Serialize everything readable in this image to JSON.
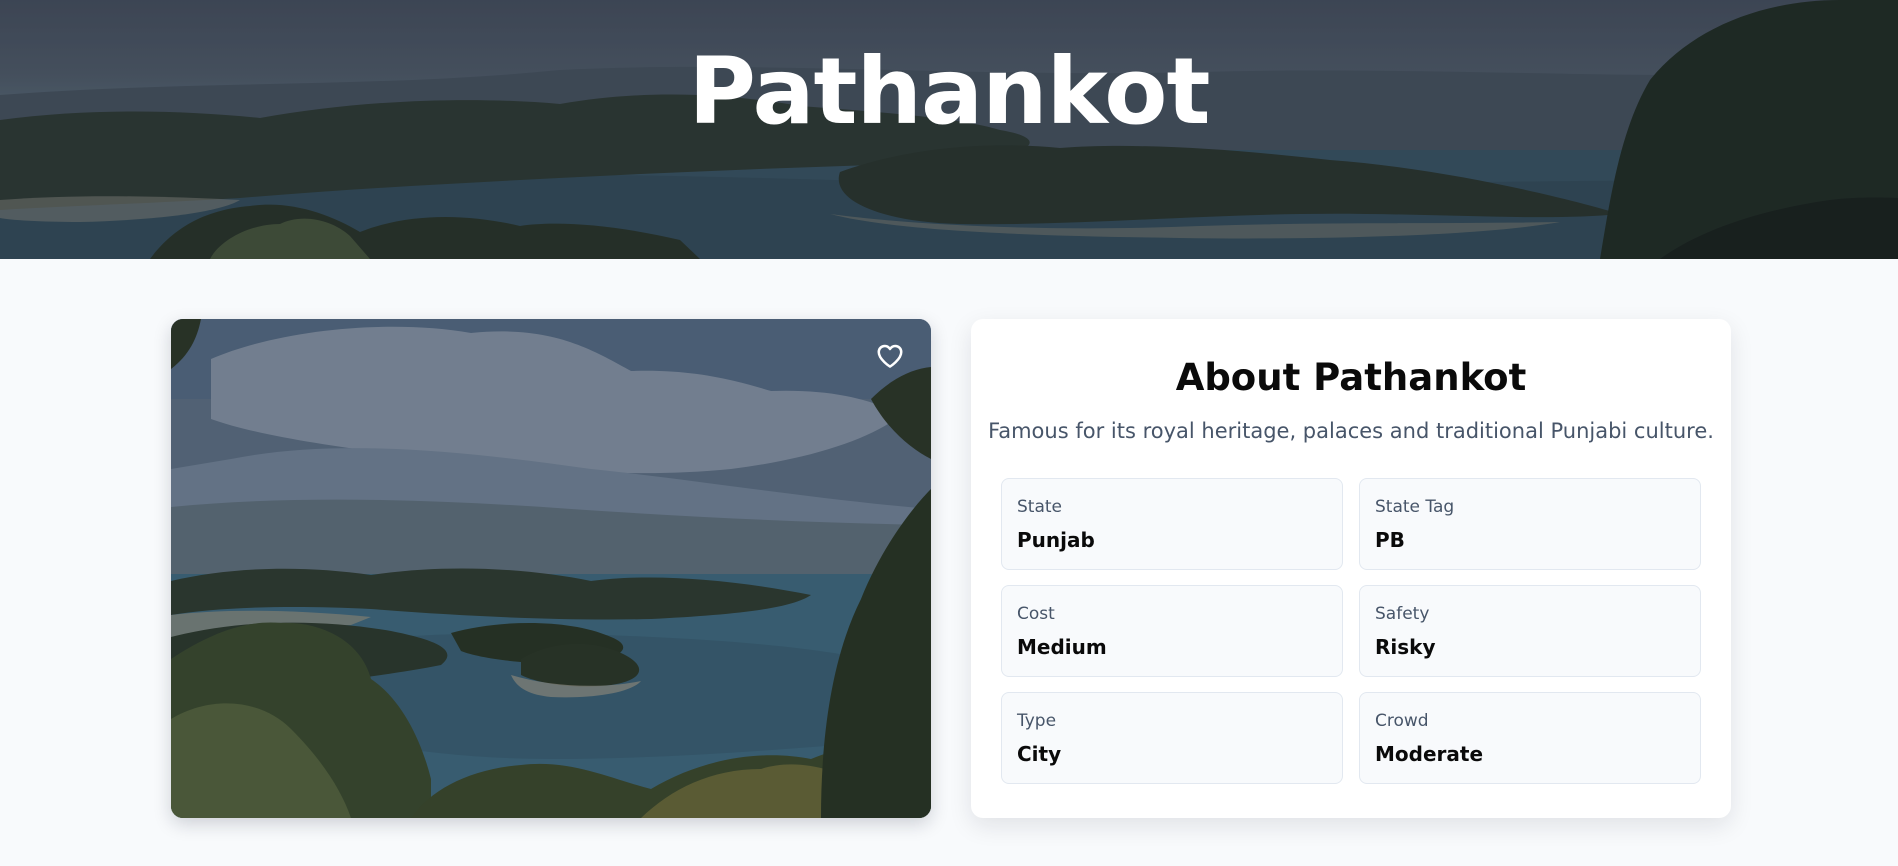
{
  "hero": {
    "title": "Pathankot"
  },
  "photo": {
    "favorite_icon": "heart-outline-icon"
  },
  "about": {
    "title": "About Pathankot",
    "description": "Famous for its royal heritage, palaces and traditional Punjabi culture.",
    "stats": [
      {
        "label": "State",
        "value": "Punjab"
      },
      {
        "label": "State Tag",
        "value": "PB"
      },
      {
        "label": "Cost",
        "value": "Medium"
      },
      {
        "label": "Safety",
        "value": "Risky"
      },
      {
        "label": "Type",
        "value": "City"
      },
      {
        "label": "Crowd",
        "value": "Moderate"
      }
    ]
  },
  "colors": {
    "page_bg": "#f8fafc",
    "card_bg": "#ffffff",
    "stat_bg": "#f8fafc",
    "stat_border": "#e2e8f0",
    "muted_text": "#475569",
    "heading_text": "#0a0a0a"
  }
}
